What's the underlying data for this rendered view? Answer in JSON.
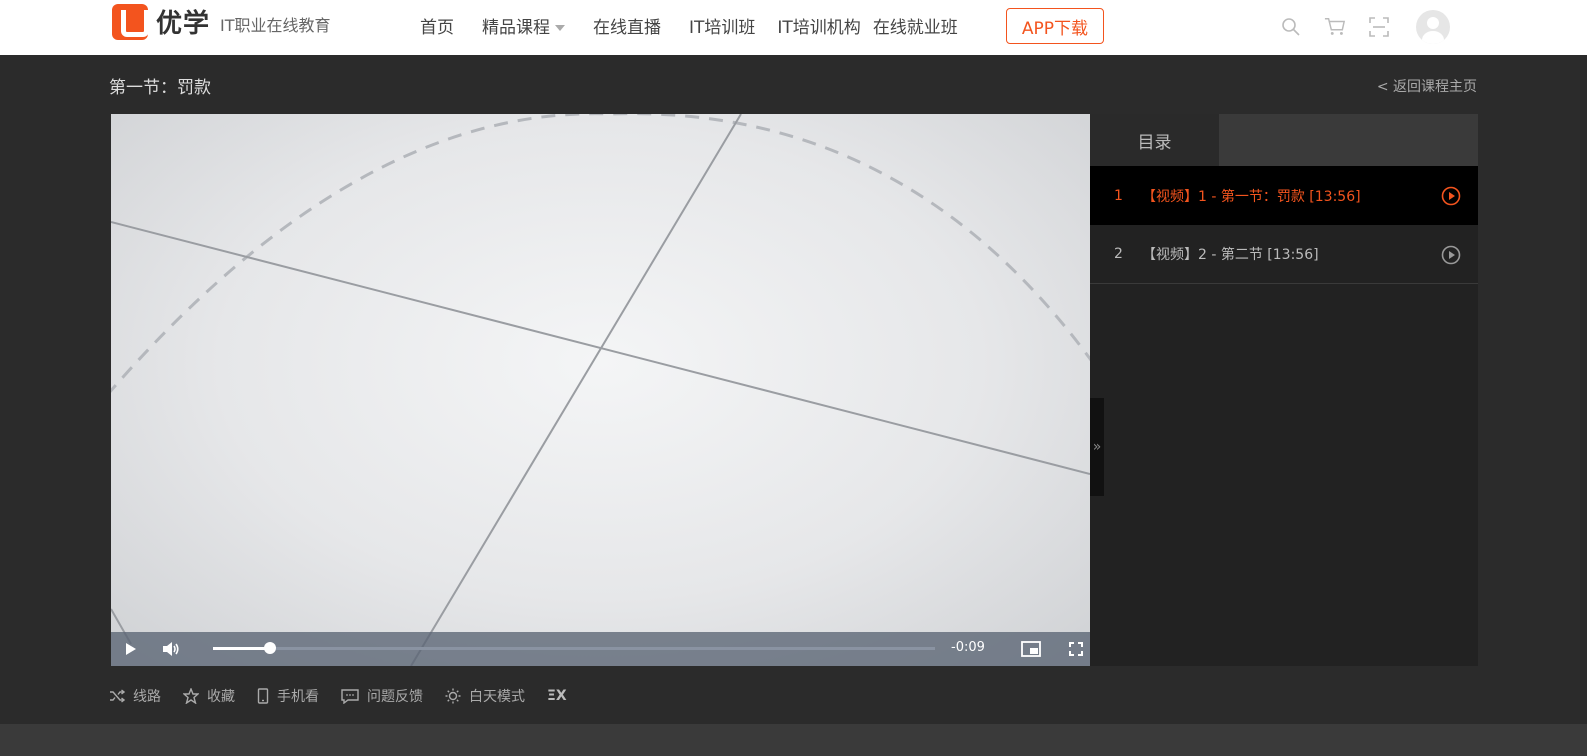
{
  "header": {
    "logo_text": "优学",
    "logo_subtitle": "IT职业在线教育",
    "nav": [
      "首页",
      "精品课程",
      "在线直播",
      "IT培训班",
      "IT培训机构",
      "在线就业班"
    ],
    "app_button": "APP下载",
    "icons": [
      "search-icon",
      "cart-icon",
      "scan-icon",
      "avatar"
    ]
  },
  "lesson": {
    "title": "第一节：罚款",
    "back_link": "< 返回课程主页"
  },
  "player": {
    "time_remaining": "-0:09",
    "progress_fraction": 0.079,
    "icons": [
      "play-icon",
      "volume-icon",
      "picture-in-picture-icon",
      "fullscreen-icon"
    ]
  },
  "playlist": {
    "tab": "目录",
    "items": [
      {
        "num": "1",
        "text": "【视频】1 - 第一节：罚款 [13:56]",
        "active": true
      },
      {
        "num": "2",
        "text": "【视频】2 - 第二节 [13:56]",
        "active": false
      }
    ],
    "toggle": "»"
  },
  "toolbar": {
    "route": "线路",
    "favorite": "收藏",
    "mobile": "手机看",
    "feedback": "问题反馈",
    "day_mode": "白天模式",
    "extra": "ΞX"
  },
  "colors": {
    "accent": "#f3541e",
    "background": "#2b2b2b",
    "header_bg": "#ffffff"
  }
}
